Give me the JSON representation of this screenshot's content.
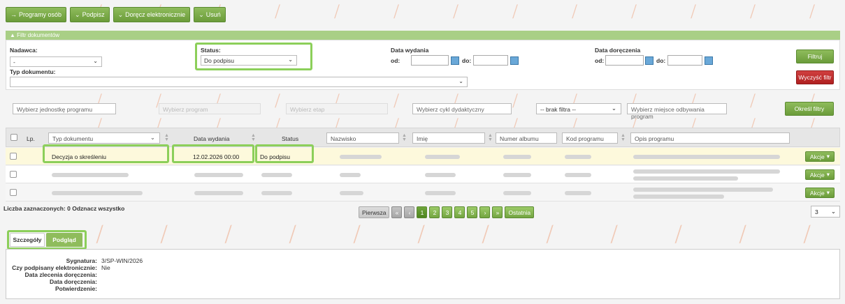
{
  "toolbar": {
    "buttons": [
      {
        "label": "Programy osób",
        "icon": "arrow-right-icon"
      },
      {
        "label": "Podpisz",
        "icon": "chevron-down-icon"
      },
      {
        "label": "Doręcz elektronicznie",
        "icon": "chevron-down-icon"
      },
      {
        "label": "Usuń",
        "icon": "chevron-down-icon"
      }
    ]
  },
  "filter": {
    "header": "Filtr dokumentów",
    "nadawca_label": "Nadawca:",
    "nadawca_value": "-",
    "typ_label": "Typ dokumentu:",
    "typ_value": "",
    "status_label": "Status:",
    "status_value": "Do podpisu",
    "data_wydania_label": "Data wydania",
    "data_doreczenia_label": "Data doręczenia",
    "od_label": "od:",
    "do_label": "do:",
    "filtruj": "Filtruj",
    "wyczysc": "Wyczyść filtr"
  },
  "secondary_filter": {
    "jednostka": "Wybierz jednostkę programu",
    "program": "Wybierz program",
    "etap": "Wybierz etap",
    "cykl": "Wybierz cykl dydaktyczny",
    "brak_filtra": "-- brak filtra --",
    "miejsce": "Wybierz miejsce odbywania program",
    "okresl": "Określ filtry"
  },
  "table": {
    "headers": {
      "lp": "Lp.",
      "typ": "Typ dokumentu",
      "data": "Data wydania",
      "status": "Status",
      "nazwisko": "Nazwisko",
      "imie": "Imię",
      "album": "Numer albumu",
      "kod": "Kod programu",
      "opis": "Opis programu"
    },
    "rows": [
      {
        "typ": "Decyzja o skreśleniu",
        "data": "12.02.2026 00:00",
        "status": "Do podpisu",
        "akcje": "Akcje"
      },
      {
        "typ": "",
        "data": "",
        "status": "",
        "akcje": "Akcje"
      },
      {
        "typ": "",
        "data": "",
        "status": "",
        "akcje": "Akcje"
      }
    ]
  },
  "selection": {
    "count_text": "Liczba zaznaczonych: 0 Odznacz wszystko"
  },
  "pagination": {
    "first": "Pierwsza",
    "first_arrow": "«",
    "prev": "‹",
    "pages": [
      "1",
      "2",
      "3",
      "4",
      "5"
    ],
    "next": "›",
    "last_arrow": "»",
    "last": "Ostatnia",
    "per_page": "3"
  },
  "tabs": {
    "szczegoly": "Szczegóły",
    "podglad": "Podgląd"
  },
  "details": {
    "sygnatura_label": "Sygnatura:",
    "sygnatura_value": "3/SP-WIN/2026",
    "podpisany_label": "Czy podpisany elektronicznie:",
    "podpisany_value": "Nie",
    "zlecenia_label": "Data zlecenia doręczenia:",
    "doreczenia_label": "Data doręczenia:",
    "potwierdzenie_label": "Potwierdzenie:"
  },
  "colors": {
    "accent_green": "#6b9c3a",
    "highlight": "#8ccf5a",
    "danger": "#b02020",
    "selected_row": "#fdf9dc"
  }
}
